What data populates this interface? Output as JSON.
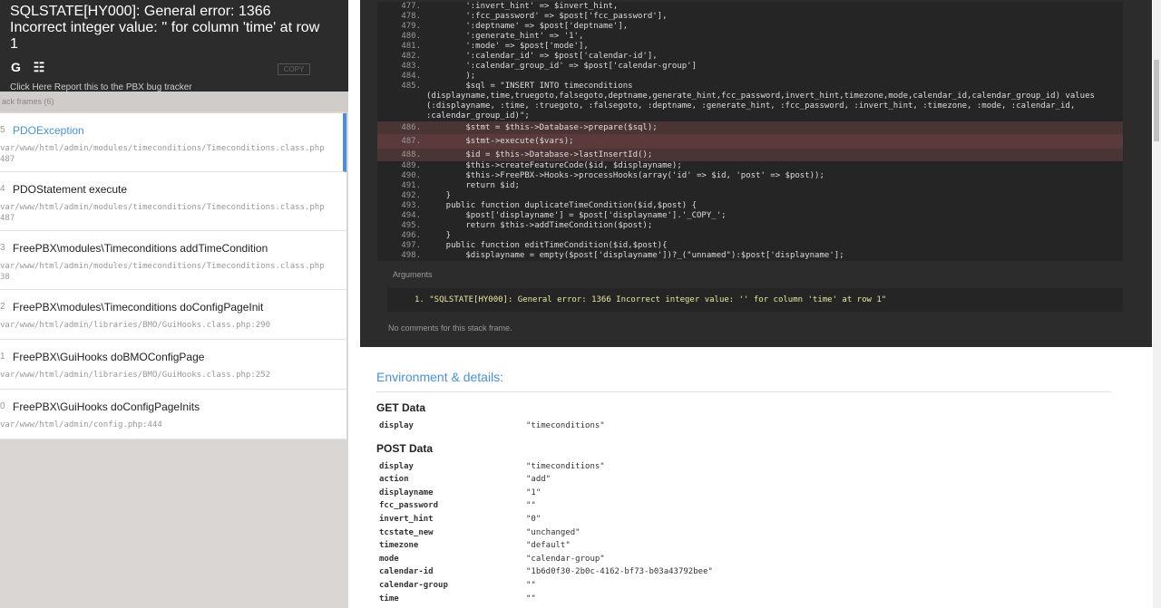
{
  "header": {
    "exception_message": "SQLSTATE[HY000]: General error: 1366 Incorrect integer value: '' for column 'time' at row 1",
    "copy_label": "COPY",
    "report_text": "Click Here Report this to the PBX bug tracker"
  },
  "frames_label": "ack frames (6)",
  "frames": [
    {
      "num": "5",
      "cls": "PDOException",
      "file": "var/www/html/admin/modules/timeconditions/Timeconditions.class.php",
      "line": "487"
    },
    {
      "num": "4",
      "cls": "PDOStatement execute",
      "file": "var/www/html/admin/modules/timeconditions/Timeconditions.class.php",
      "line": "487"
    },
    {
      "num": "3",
      "cls": "FreePBX\\modules\\Timeconditions addTimeCondition",
      "file": "var/www/html/admin/modules/timeconditions/Timeconditions.class.php",
      "line": "38"
    },
    {
      "num": "2",
      "cls": "FreePBX\\modules\\Timeconditions doConfigPageInit",
      "file": "var/www/html/admin/libraries/BMO/GuiHooks.class.php:290",
      "line": ""
    },
    {
      "num": "1",
      "cls": "FreePBX\\GuiHooks doBMOConfigPage",
      "file": "var/www/html/admin/libraries/BMO/GuiHooks.class.php:252",
      "line": ""
    },
    {
      "num": "0",
      "cls": "FreePBX\\GuiHooks doConfigPageInits",
      "file": "var/www/html/admin/config.php:444",
      "line": ""
    }
  ],
  "code_lines": [
    {
      "ln": "477.",
      "tx": "        ':invert_hint' => $invert_hint,"
    },
    {
      "ln": "478.",
      "tx": "        ':fcc_password' => $post['fcc_password'],"
    },
    {
      "ln": "479.",
      "tx": "        ':deptname' => $post['deptname'],"
    },
    {
      "ln": "480.",
      "tx": "        ':generate_hint' => '1',"
    },
    {
      "ln": "481.",
      "tx": "        ':mode' => $post['mode'],"
    },
    {
      "ln": "482.",
      "tx": "        ':calendar_id' => $post['calendar-id'],"
    },
    {
      "ln": "483.",
      "tx": "        ':calendar_group_id' => $post['calendar-group']"
    },
    {
      "ln": "484.",
      "tx": "        );"
    },
    {
      "ln": "485.",
      "tx": "        $sql = \"INSERT INTO timeconditions"
    },
    {
      "ln": "",
      "tx": "(displayname,time,truegoto,falsegoto,deptname,generate_hint,fcc_password,invert_hint,timezone,mode,calendar_id,calendar_group_id) values"
    },
    {
      "ln": "",
      "tx": "(:displayname, :time, :truegoto, :falsegoto, :deptname, :generate_hint, :fcc_password, :invert_hint, :timezone, :mode, :calendar_id,"
    },
    {
      "ln": "",
      "tx": ":calendar_group_id)\";"
    },
    {
      "ln": "486.",
      "tx": "        $stmt = $this->Database->prepare($sql);",
      "hl": "hl"
    },
    {
      "ln": "487.",
      "tx": "        $stmt->execute($vars);",
      "hl": "hl2"
    },
    {
      "ln": "488.",
      "tx": "        $id = $this->Database->lastInsertId();",
      "hl": "hl"
    },
    {
      "ln": "489.",
      "tx": "        $this->createFeatureCode($id, $displayname);"
    },
    {
      "ln": "490.",
      "tx": "        $this->FreePBX->Hooks->processHooks(array('id' => $id, 'post' => $post));"
    },
    {
      "ln": "491.",
      "tx": "        return $id;"
    },
    {
      "ln": "492.",
      "tx": "    }"
    },
    {
      "ln": "493.",
      "tx": "    public function duplicateTimeCondition($id,$post) {"
    },
    {
      "ln": "494.",
      "tx": "        $post['displayname'] = $post['displayname'].'_COPY_';"
    },
    {
      "ln": "495.",
      "tx": "        return $this->addTimeCondition($post);"
    },
    {
      "ln": "496.",
      "tx": "    }"
    },
    {
      "ln": "497.",
      "tx": "    public function editTimeCondition($id,$post){"
    },
    {
      "ln": "498.",
      "tx": "        $displayname = empty($post['displayname'])?_(\"unnamed\"):$post['displayname'];"
    }
  ],
  "args_label": "Arguments",
  "argument": "1. \"SQLSTATE[HY000]: General error: 1366 Incorrect integer value: '' for column 'time' at row 1\"",
  "no_comments": "No comments for this stack frame.",
  "env": {
    "title": "Environment & details:",
    "get_title": "GET Data",
    "get": [
      {
        "k": "display",
        "v": "\"timeconditions\""
      }
    ],
    "post_title": "POST Data",
    "post": [
      {
        "k": "display",
        "v": "\"timeconditions\""
      },
      {
        "k": "action",
        "v": "\"add\""
      },
      {
        "k": "displayname",
        "v": "\"1\""
      },
      {
        "k": "fcc_password",
        "v": "\"\""
      },
      {
        "k": "invert_hint",
        "v": "\"0\""
      },
      {
        "k": "tcstate_new",
        "v": "\"unchanged\""
      },
      {
        "k": "timezone",
        "v": "\"default\""
      },
      {
        "k": "mode",
        "v": "\"calendar-group\""
      },
      {
        "k": "calendar-id",
        "v": "\"1b6d0f30-2b0c-4162-bf73-b03a43792bee\""
      },
      {
        "k": "calendar-group",
        "v": "\"\""
      },
      {
        "k": "time",
        "v": "\"\""
      }
    ]
  }
}
